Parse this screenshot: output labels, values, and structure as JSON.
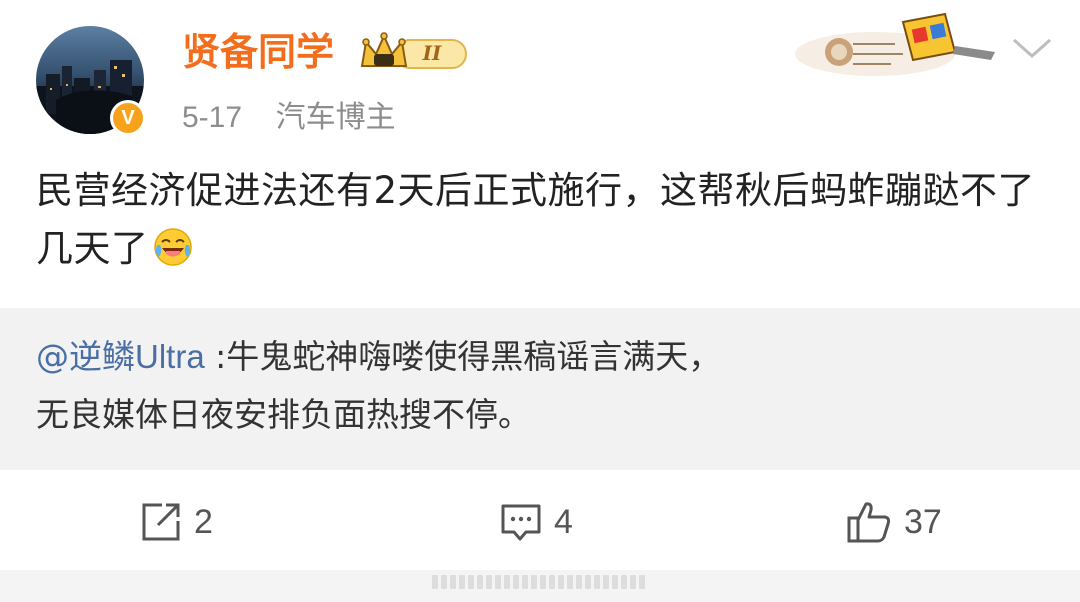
{
  "header": {
    "username": "贤备同学",
    "vip_level": "II",
    "date": "5-17",
    "role": "汽车博主",
    "verified_badge": "V"
  },
  "post": {
    "text": "民营经济促进法还有2天后正式施行，这帮秋后蚂蚱蹦跶不了几天了",
    "emoji_icon": "laugh-cry-icon"
  },
  "repost": {
    "mention": "@逆鳞",
    "mention_suffix": "Ultra",
    "line1": " :牛鬼蛇神嗨喽使得黑稿谣言满天，",
    "line2": "无良媒体日夜安排负面热搜不停。"
  },
  "actions": {
    "share_count": "2",
    "comment_count": "4",
    "like_count": "37"
  },
  "colors": {
    "username": "#f26e1c",
    "mention": "#4a6fa5",
    "repost_bg": "#f2f2f2",
    "meta": "#8d8d8d"
  }
}
